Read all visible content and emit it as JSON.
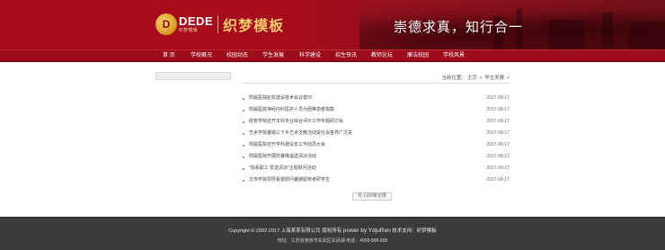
{
  "header": {
    "logo_dede": "DEDE",
    "logo_sub": "织梦模板",
    "logo_cn": "织梦模板",
    "slogan": "崇德求真，知行合一",
    "colors": {
      "primary": "#a60d1c",
      "nav": "#9c0b19",
      "footer": "#3b3b3b",
      "gold": "#f4c86a"
    }
  },
  "nav": {
    "items": [
      {
        "label": "首 页"
      },
      {
        "label": "学校概况"
      },
      {
        "label": "校园动态"
      },
      {
        "label": "学生发展"
      },
      {
        "label": "科学建设"
      },
      {
        "label": "招生快讯"
      },
      {
        "label": "教师论坛"
      },
      {
        "label": "廉洁校园"
      },
      {
        "label": "学校风景"
      }
    ]
  },
  "breadcrumb": {
    "prefix": "当前位置：",
    "home": "主页",
    "sep1": ">",
    "current": "学生发展",
    "sep2": ">"
  },
  "articles": [
    {
      "title": "附属医院赴杭建设技术会议暨印",
      "date": "2017-08-17"
    },
    {
      "title": "附属医院神经内科医护人员为困难患者捐款",
      "date": "2017-08-17"
    },
    {
      "title": "经管学院召开本科专业综合评价工作专题研讨会",
      "date": "2017-08-17"
    },
    {
      "title": "艺术学院暑期三下乡艺术支教活动受社会各界广泛关",
      "date": "2017-08-17"
    },
    {
      "title": "附属医院召开学科建设年工作动员大会",
      "date": "2017-08-17"
    },
    {
      "title": "附属医院开展防暑降温送清凉活动",
      "date": "2017-08-17"
    },
    {
      "title": "“情系职工 爱送清凉”主题慰问活动",
      "date": "2017-08-17"
    },
    {
      "title": "文传学院领导看望慰问暑期留校考研学生",
      "date": "2017-08-17"
    }
  ],
  "pager": {
    "text": "共 1页8条记录"
  },
  "footer": {
    "line1_prefix": "Copyright © 2002-2017 上海某某有限公司 版权所有",
    "powered": "power by YdjuRen",
    "support_label": "技术支持：",
    "support_link": "织梦模板",
    "line2": "地址：江苏省南京市玄武区玄武湖 电话：4008-888-888"
  }
}
